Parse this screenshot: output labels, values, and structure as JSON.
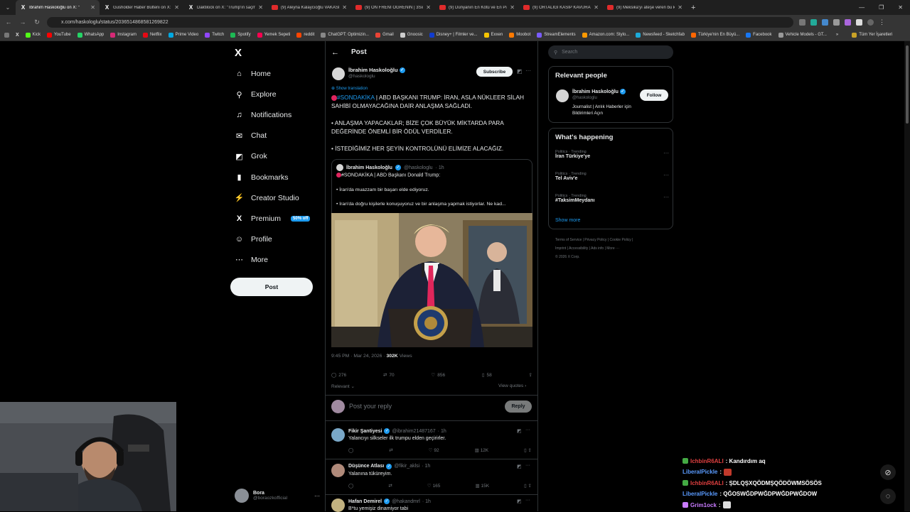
{
  "browser": {
    "tabs": [
      {
        "title": "İbrahim Haskoloğlu on X: \"",
        "fav": "x",
        "active": true
      },
      {
        "title": "Gusholder Haber Bülteni on X:",
        "fav": "x"
      },
      {
        "title": "Daktilock on X: \"Trump'ın saçm",
        "fav": "x"
      },
      {
        "title": "(9) Aleyna Kalaycıoğlu VAKASI",
        "fav": "yt"
      },
      {
        "title": "(9) ÖN FRENİ ÖĞRENİN | 3Sıraf",
        "fav": "yt"
      },
      {
        "title": "(9) Dünyanın En Kötü ve En Pi",
        "fav": "yt"
      },
      {
        "title": "(9) ORTALIĞI KASIP KAVURAN Y",
        "fav": "yt"
      },
      {
        "title": "(9) Meksika'yı ateşe veren bu k",
        "fav": "yt"
      }
    ],
    "new_tab": "+",
    "url": "x.com/haskologlu/status/2036514868581269822",
    "bookmarks": [
      {
        "label": "Kick",
        "color": "#53fc18"
      },
      {
        "label": "YouTube",
        "color": "#ff0000"
      },
      {
        "label": "WhatsApp",
        "color": "#25d366"
      },
      {
        "label": "Instagram",
        "color": "#d62976"
      },
      {
        "label": "Netflix",
        "color": "#e50914"
      },
      {
        "label": "Prime Video",
        "color": "#00a8e1"
      },
      {
        "label": "Twitch",
        "color": "#9146ff"
      },
      {
        "label": "Spotify",
        "color": "#1db954"
      },
      {
        "label": "Yemek Sepeti",
        "color": "#fa0050"
      },
      {
        "label": "reddit",
        "color": "#ff4500"
      },
      {
        "label": "ChatGPT: Optimizin...",
        "color": "#888888"
      },
      {
        "label": "Gmail",
        "color": "#ea4335"
      },
      {
        "label": "Gnoosic",
        "color": "#cccccc"
      },
      {
        "label": "Disney+ | Filmler ve...",
        "color": "#113ccf"
      },
      {
        "label": "Exxen",
        "color": "#f5c400"
      },
      {
        "label": "Moobot",
        "color": "#ff7a00"
      },
      {
        "label": "StreamElements",
        "color": "#7a5cff"
      },
      {
        "label": "Amazon.com: Stylo...",
        "color": "#ff9900"
      },
      {
        "label": "Newsfeed - Sketchfab",
        "color": "#1caad9"
      },
      {
        "label": "Türkiye'nin En Büyü...",
        "color": "#ff6600"
      },
      {
        "label": "Facebook",
        "color": "#1877f2"
      },
      {
        "label": "Vehicle Models - GT...",
        "color": "#999999"
      }
    ],
    "bookmarks_more": "»",
    "all_bookmarks": "Tüm Yer İşaretleri"
  },
  "nav": {
    "items": [
      {
        "label": "Home",
        "icon": "home-icon",
        "glyph": "⌂"
      },
      {
        "label": "Explore",
        "icon": "search-icon",
        "glyph": "⚲"
      },
      {
        "label": "Notifications",
        "icon": "bell-icon",
        "glyph": "♫"
      },
      {
        "label": "Chat",
        "icon": "envelope-icon",
        "glyph": "✉"
      },
      {
        "label": "Grok",
        "icon": "grok-icon",
        "glyph": "◩"
      },
      {
        "label": "Bookmarks",
        "icon": "bookmark-icon",
        "glyph": "▮"
      },
      {
        "label": "Creator Studio",
        "icon": "creator-studio-icon",
        "glyph": "⚡"
      },
      {
        "label": "Premium",
        "icon": "x-icon",
        "glyph": "X",
        "badge": "50% off"
      },
      {
        "label": "Profile",
        "icon": "profile-icon",
        "glyph": "☺"
      },
      {
        "label": "More",
        "icon": "more-circle-icon",
        "glyph": "⋯"
      }
    ],
    "post_button": "Post",
    "account": {
      "name": "Bora",
      "handle": "@boraozkofficial",
      "more": "···"
    }
  },
  "post": {
    "header_title": "Post",
    "author_name": "İbrahim Haskoloğlu",
    "author_handle": "@haskologlu",
    "subscribe": "Subscribe",
    "show_translation": "Show translation",
    "hashtag": "#SONDAKİKA",
    "line1": " | ABD BAŞKANI TRUMP: İRAN, ASLA NÜKLEER SİLAH SAHİBİ OLMAYACAĞINA DAİR ANLAŞMA SAĞLADI.",
    "line2": "• ANLAŞMA YAPACAKLAR; BİZE ÇOK BÜYÜK MİKTARDA PARA DEĞERİNDE ÖNEMLİ BİR ÖDÜL VERDİLER.",
    "line3": "• İSTEDİĞİMİZ HER ŞEYİN KONTROLÜNÜ ELİMİZE ALACAĞIZ.",
    "quote": {
      "author": "İbrahim Haskoloğlu",
      "handle": "@haskologlu",
      "time": "· 1h",
      "title": "#SONDAKİKA | ABD Başkanı Donald Trump:",
      "b1": "• İran'da muazzam bir başarı elde ediyoruz.",
      "b2": "• İran'da doğru kişilerle konuşuyoruz ve bir anlaşma yapmak istiyorlar. Ne kad..."
    },
    "time": "9:45 PM · Mar 24, 2026 · ",
    "views": "302K",
    "views_label": " Views",
    "stats": {
      "replies": "276",
      "reposts": "70",
      "likes": "856",
      "bookmarks": "58"
    },
    "relevant": "Relevant ⌄",
    "view_quotes": "View quotes ›",
    "reply_placeholder": "Post your reply",
    "reply_button": "Reply"
  },
  "replies": [
    {
      "name": "Fikir Şantiyesi",
      "handle": "@ibrahim21487167",
      "time": "· 1h",
      "text": "Yalancıyı silkseler ilk trumpu elden geçirirler.",
      "likes": "92",
      "views": "12K"
    },
    {
      "name": "Düşünce Atlası",
      "handle": "@fikir_aklsi",
      "time": "· 1h",
      "text": "Yalanına tüküreyim.",
      "likes": "165",
      "views": "15K"
    },
    {
      "name": "Hafan Demirel",
      "handle": "@hakandmrl",
      "time": "· 1h",
      "text": "B*tu yemişiz dinamiyor tabi",
      "likes": "",
      "views": ""
    }
  ],
  "right": {
    "search_placeholder": "Search",
    "relevant_title": "Relevant people",
    "person": {
      "name": "İbrahim Haskoloğlu",
      "handle": "@haskologlu",
      "bio": "Journalist | Anlık Haberler için Bildirimleri Açın",
      "follow": "Follow"
    },
    "happening_title": "What's happening",
    "trends": [
      {
        "cat": "Politics · Trending",
        "name": "İran Türkiye'ye"
      },
      {
        "cat": "Politics · Trending",
        "name": "Tel Aviv'e"
      },
      {
        "cat": "Politics · Trending",
        "name": "#TaksimMeydanı"
      }
    ],
    "show_more": "Show more",
    "footer1": "Terms of Service  |  Privacy Policy  |  Cookie Policy  |",
    "footer2": "Imprint  |  Accessibility  |  Ads info  |  More ···",
    "footer3": "© 2026 X Corp."
  },
  "chat": [
    {
      "user": "IchbinR6ALI",
      "color": "#e04040",
      "msg": ": Kandırdım aq",
      "badge": "#44aa44"
    },
    {
      "user": "LiberalPickle",
      "color": "#5a9bff",
      "msg": ": ",
      "emote": "#c0392b"
    },
    {
      "user": "IchbinR6ALI",
      "color": "#e04040",
      "msg": ": ŞDLQŞXQÖDMŞQÖDÖWMSÖSÖS",
      "badge": "#44aa44"
    },
    {
      "user": "LiberalPickle",
      "color": "#5a9bff",
      "msg": ": QĞOSWĞDPWĞDPWĞDPWĞDOW"
    },
    {
      "user": "Grim1ock",
      "color": "#c97bff",
      "msg": ": ",
      "badge": "#c97bff",
      "emote": "#dddddd"
    }
  ]
}
